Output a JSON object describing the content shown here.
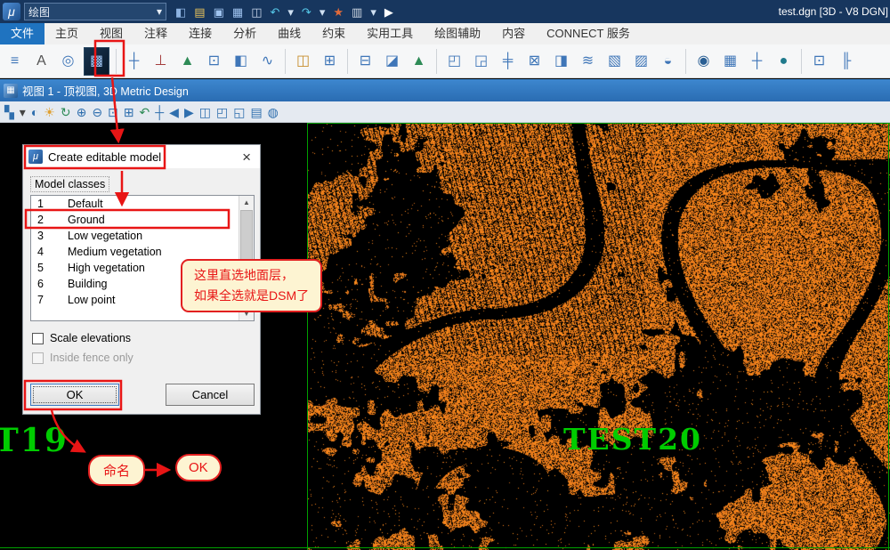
{
  "app": {
    "logo_glyph": "μ",
    "title": "test.dgn [3D - V8 DGN]",
    "tool_combo_label": "绘图",
    "titlebar_icons": [
      {
        "name": "active-color-icon",
        "glyph": "◧",
        "color": "#8db3e2"
      },
      {
        "name": "open-file-icon",
        "glyph": "▤",
        "color": "#e8c35a"
      },
      {
        "name": "save-icon",
        "glyph": "▣",
        "color": "#9fc3ef"
      },
      {
        "name": "save-settings-icon",
        "glyph": "▦",
        "color": "#9fc3ef"
      },
      {
        "name": "copy-icon",
        "glyph": "◫",
        "color": "#c8d6ea"
      },
      {
        "name": "undo-icon",
        "glyph": "↶",
        "color": "#56c8e8"
      },
      {
        "name": "undo-caret-icon",
        "glyph": "▾",
        "color": "#cfe0f2"
      },
      {
        "name": "redo-icon",
        "glyph": "↷",
        "color": "#56c8e8"
      },
      {
        "name": "redo-caret-icon",
        "glyph": "▾",
        "color": "#cfe0f2"
      },
      {
        "name": "pushpin-icon",
        "glyph": "★",
        "color": "#e06a3a"
      },
      {
        "name": "print-icon",
        "glyph": "▥",
        "color": "#cfd8e4"
      },
      {
        "name": "print-caret-icon",
        "glyph": "▾",
        "color": "#cfe0f2"
      },
      {
        "name": "selection-arrow-icon",
        "glyph": "▶",
        "color": "#ffffff"
      }
    ]
  },
  "ribbon": {
    "tabs": [
      {
        "label": "文件",
        "active": true
      },
      {
        "label": "主页",
        "active": false
      },
      {
        "label": "视图",
        "active": false
      },
      {
        "label": "注释",
        "active": false
      },
      {
        "label": "连接",
        "active": false
      },
      {
        "label": "分析",
        "active": false
      },
      {
        "label": "曲线",
        "active": false
      },
      {
        "label": "约束",
        "active": false
      },
      {
        "label": "实用工具",
        "active": false
      },
      {
        "label": "绘图辅助",
        "active": false
      },
      {
        "label": "内容",
        "active": false
      },
      {
        "label": "CONNECT 服务",
        "active": false
      }
    ],
    "icons": [
      {
        "name": "element-list-icon",
        "glyph": "≡",
        "color": "#3f76b8"
      },
      {
        "name": "text-format-icon",
        "glyph": "A",
        "color": "#555555"
      },
      {
        "name": "snap-point-icon",
        "glyph": "◎",
        "color": "#3f76b8"
      },
      {
        "name": "create-editable-model-icon",
        "glyph": "▩",
        "color": "#0b1e33",
        "highlight": true
      },
      {
        "sep": true
      },
      {
        "name": "axis-tool-icon",
        "glyph": "┼",
        "color": "#3f76b8"
      },
      {
        "name": "survey-pole-icon",
        "glyph": "⊥",
        "color": "#a33c3c"
      },
      {
        "name": "flag-point-icon",
        "glyph": "▲",
        "color": "#2e8b57"
      },
      {
        "name": "image-frame-icon",
        "glyph": "⊡",
        "color": "#3f76b8"
      },
      {
        "name": "profile-view-icon",
        "glyph": "◧",
        "color": "#3f76b8"
      },
      {
        "name": "curve-tool-icon",
        "glyph": "∿",
        "color": "#3f76b8"
      },
      {
        "sep": true
      },
      {
        "name": "coordinate-list-icon",
        "glyph": "◫",
        "color": "#c78f2e"
      },
      {
        "name": "grid-tool-icon",
        "glyph": "⊞",
        "color": "#3f76b8"
      },
      {
        "sep": true
      },
      {
        "name": "table-tool-icon",
        "glyph": "⊟",
        "color": "#3f76b8"
      },
      {
        "name": "shade-view-icon",
        "glyph": "◪",
        "color": "#3f76b8"
      },
      {
        "name": "tree-tool-icon",
        "glyph": "▲",
        "color": "#2e8b57"
      },
      {
        "sep": true
      },
      {
        "name": "align-quadrant-icon",
        "glyph": "◰",
        "color": "#3f76b8"
      },
      {
        "name": "section-tool-icon",
        "glyph": "◲",
        "color": "#3f76b8"
      },
      {
        "name": "cross-section-icon",
        "glyph": "╪",
        "color": "#3f76b8"
      },
      {
        "name": "clip-box-icon",
        "glyph": "⊠",
        "color": "#3f76b8"
      },
      {
        "name": "half-shade-icon",
        "glyph": "◨",
        "color": "#3f76b8"
      },
      {
        "name": "wave-smooth-icon",
        "glyph": "≋",
        "color": "#3f76b8"
      },
      {
        "name": "hatch-left-icon",
        "glyph": "▧",
        "color": "#3f76b8"
      },
      {
        "name": "hatch-right-icon",
        "glyph": "▨",
        "color": "#3f76b8"
      },
      {
        "name": "contour-tool-icon",
        "glyph": "◒",
        "color": "#3f76b8"
      },
      {
        "sep": true
      },
      {
        "name": "target-view-icon",
        "glyph": "◉",
        "color": "#2a5f94"
      },
      {
        "name": "raster-grid-icon",
        "glyph": "▦",
        "color": "#3f76b8"
      },
      {
        "name": "crosshair-icon",
        "glyph": "┼",
        "color": "#3f76b8"
      },
      {
        "name": "globe-icon",
        "glyph": "●",
        "color": "#1f7a8c"
      },
      {
        "sep": true
      },
      {
        "name": "cell-box-icon",
        "glyph": "⊡",
        "color": "#3f76b8"
      },
      {
        "name": "fence-tool-icon",
        "glyph": "╟",
        "color": "#3f76b8"
      }
    ]
  },
  "view": {
    "title": "视图 1 - 顶视图, 3D Metric Design",
    "toolbar_icons": [
      {
        "name": "view-attributes-icon",
        "glyph": "▚",
        "color": "#2f6fae"
      },
      {
        "name": "view-attributes-caret-icon",
        "glyph": "▾",
        "color": "#444444"
      },
      {
        "name": "display-style-icon",
        "glyph": "◐",
        "color": "#2f6fae"
      },
      {
        "name": "view-brightness-icon",
        "glyph": "☀",
        "color": "#e0a030"
      },
      {
        "name": "update-view-icon",
        "glyph": "↻",
        "color": "#2e8b57"
      },
      {
        "name": "zoom-in-icon",
        "glyph": "⊕",
        "color": "#2f6fae"
      },
      {
        "name": "zoom-out-icon",
        "glyph": "⊖",
        "color": "#2f6fae"
      },
      {
        "name": "window-area-icon",
        "glyph": "⊡",
        "color": "#2f6fae"
      },
      {
        "name": "fit-view-icon",
        "glyph": "⊞",
        "color": "#2f6fae"
      },
      {
        "name": "rotate-view-icon",
        "glyph": "↶",
        "color": "#2e8b57"
      },
      {
        "name": "pan-view-icon",
        "glyph": "┼",
        "color": "#2f6fae"
      },
      {
        "name": "view-previous-icon",
        "glyph": "◀",
        "color": "#2f6fae"
      },
      {
        "name": "view-next-icon",
        "glyph": "▶",
        "color": "#2f6fae"
      },
      {
        "name": "copy-view-icon",
        "glyph": "◫",
        "color": "#2f6fae"
      },
      {
        "name": "clip-volume-icon",
        "glyph": "◰",
        "color": "#2f6fae"
      },
      {
        "name": "clip-mask-icon",
        "glyph": "◱",
        "color": "#2f6fae"
      },
      {
        "name": "saved-views-icon",
        "glyph": "▤",
        "color": "#2f6fae"
      },
      {
        "name": "view-rotation-icon",
        "glyph": "◍",
        "color": "#2f6fae"
      }
    ]
  },
  "dialog": {
    "title": "Create editable model",
    "group_label": "Model classes",
    "classes": [
      {
        "num": "1",
        "name": "Default"
      },
      {
        "num": "2",
        "name": "Ground"
      },
      {
        "num": "3",
        "name": "Low vegetation"
      },
      {
        "num": "4",
        "name": "Medium vegetation"
      },
      {
        "num": "5",
        "name": "High vegetation"
      },
      {
        "num": "6",
        "name": "Building"
      },
      {
        "num": "7",
        "name": "Low point"
      }
    ],
    "scale_elevations_label": "Scale elevations",
    "inside_fence_label": "Inside fence only",
    "ok_label": "OK",
    "cancel_label": "Cancel"
  },
  "annotations": {
    "accent_color": "#e81515",
    "callout_line1": "这里直选地面层，",
    "callout_line2": "如果全选就是DSM了",
    "naming_label": "命名",
    "ok_label": "OK"
  },
  "canvas": {
    "label_left": "T19",
    "label_right": "TEST20",
    "label_color": "#00cc00",
    "background": "#000000",
    "point_color": "#ef7d1e",
    "grid_line_color": "#00a000"
  }
}
